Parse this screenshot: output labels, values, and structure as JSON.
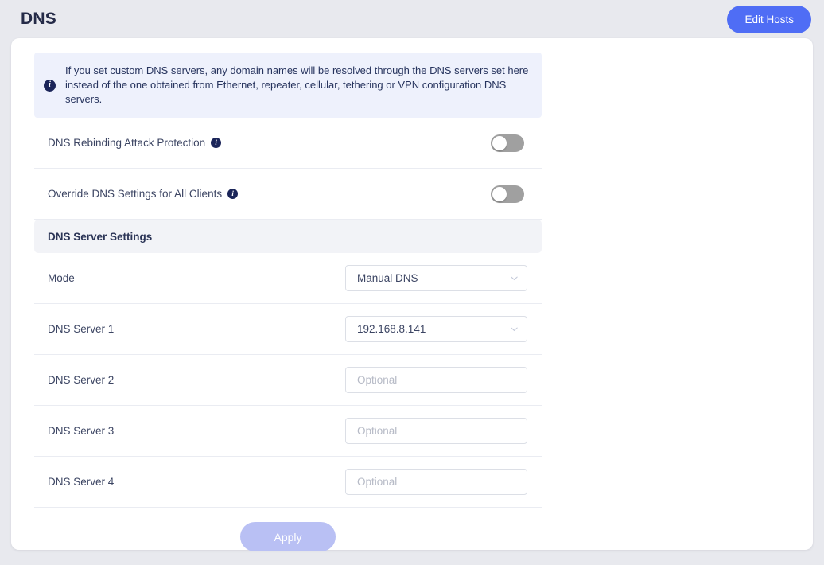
{
  "header": {
    "title": "DNS",
    "edit_hosts_label": "Edit Hosts",
    "accent_color": "#4f6df5"
  },
  "banner": {
    "icon": "info-icon",
    "text": "If you set custom DNS servers, any domain names will be resolved through the DNS servers set here instead of the one obtained from Ethernet, repeater, cellular, tethering or VPN configuration DNS servers.",
    "background_color": "#eef1fc"
  },
  "toggles": [
    {
      "label": "DNS Rebinding Attack Protection",
      "info_icon": "info-icon",
      "state": "off",
      "track_color": "#a0a0a0"
    },
    {
      "label": "Override DNS Settings for All Clients",
      "info_icon": "info-icon",
      "state": "off",
      "track_color": "#a0a0a0"
    }
  ],
  "section": {
    "title": "DNS Server Settings"
  },
  "fields": [
    {
      "label": "Mode",
      "type": "select",
      "value": "Manual DNS",
      "placeholder": "",
      "chevron_icon": "chevron-down-icon"
    },
    {
      "label": "DNS Server 1",
      "type": "select",
      "value": "192.168.8.141",
      "placeholder": "",
      "chevron_icon": "chevron-down-icon"
    },
    {
      "label": "DNS Server 2",
      "type": "text",
      "value": "",
      "placeholder": "Optional"
    },
    {
      "label": "DNS Server 3",
      "type": "text",
      "value": "",
      "placeholder": "Optional"
    },
    {
      "label": "DNS Server 4",
      "type": "text",
      "value": "",
      "placeholder": "Optional"
    }
  ],
  "apply": {
    "label": "Apply",
    "state": "disabled",
    "color": "#b9c0f4"
  }
}
